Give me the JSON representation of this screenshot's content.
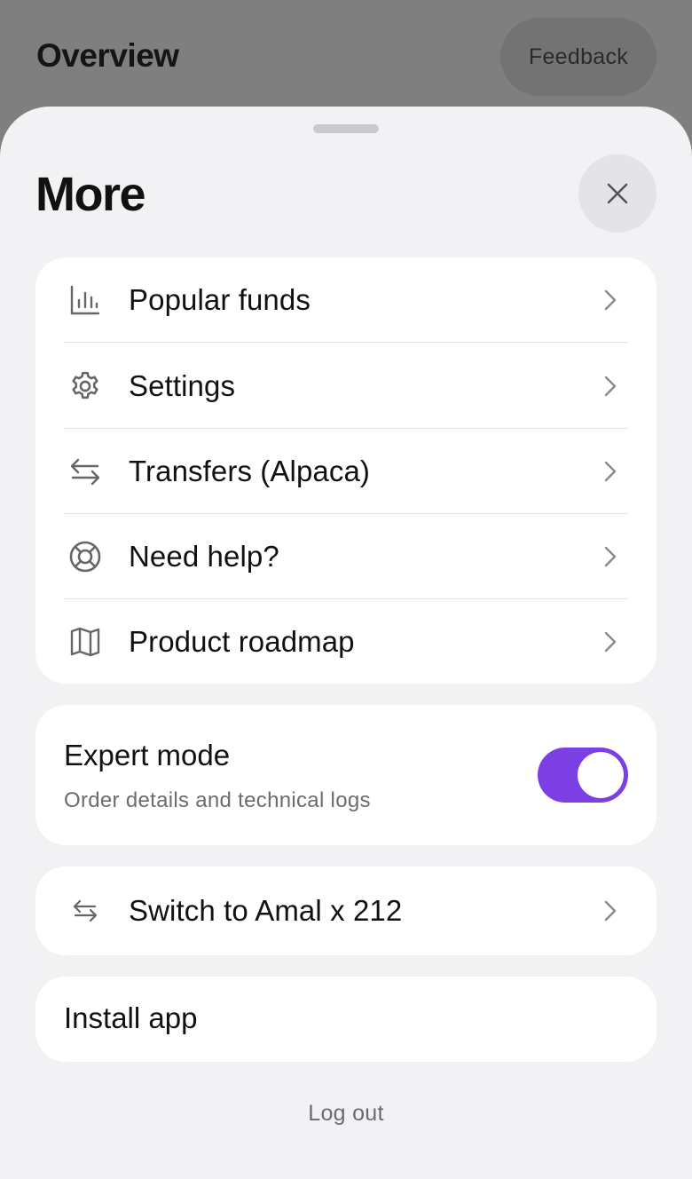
{
  "background": {
    "title": "Overview",
    "feedback_label": "Feedback"
  },
  "sheet": {
    "title": "More",
    "close_icon": "close-icon",
    "menu": [
      {
        "label": "Popular funds",
        "icon": "bar-chart-icon"
      },
      {
        "label": "Settings",
        "icon": "gear-icon"
      },
      {
        "label": "Transfers (Alpaca)",
        "icon": "transfer-arrows-icon"
      },
      {
        "label": "Need help?",
        "icon": "lifebuoy-icon"
      },
      {
        "label": "Product roadmap",
        "icon": "map-icon"
      }
    ],
    "expert_mode": {
      "title": "Expert mode",
      "subtitle": "Order details and technical logs",
      "enabled": true
    },
    "switch_account": {
      "label": "Switch to Amal x 212",
      "icon": "switch-arrows-icon"
    },
    "install_label": "Install app",
    "logout_label": "Log out"
  },
  "colors": {
    "accent": "#7b3fe4",
    "overlay": "#7f7f7f",
    "sheet_bg": "#f2f2f5",
    "card_bg": "#ffffff"
  }
}
